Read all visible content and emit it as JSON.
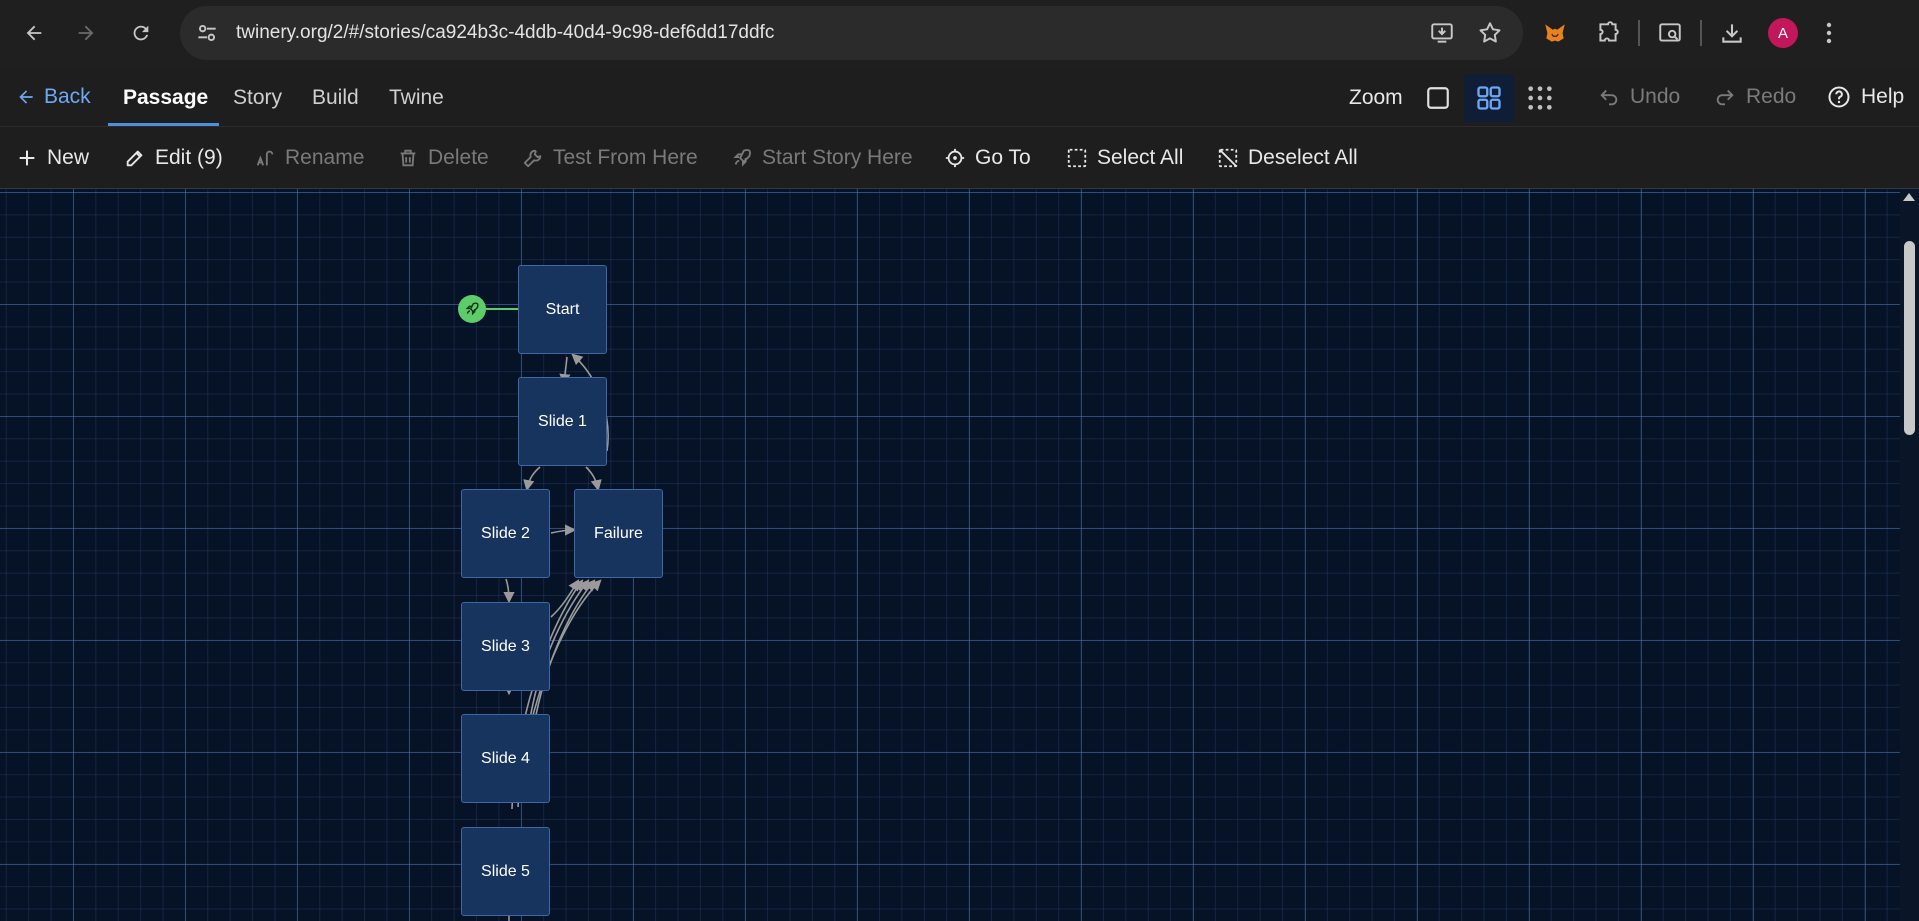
{
  "browser": {
    "url": "twinery.org/2/#/stories/ca924b3c-4ddb-40d4-9c98-def6dd17ddfc",
    "avatar_letter": "A"
  },
  "topbar": {
    "back_label": "Back",
    "tabs": [
      {
        "label": "Passage",
        "active": true
      },
      {
        "label": "Story",
        "active": false
      },
      {
        "label": "Build",
        "active": false
      },
      {
        "label": "Twine",
        "active": false
      }
    ],
    "zoom_label": "Zoom",
    "undo_label": "Undo",
    "redo_label": "Redo",
    "help_label": "Help"
  },
  "actions": {
    "new_label": "New",
    "edit_label": "Edit (9)",
    "rename_label": "Rename",
    "delete_label": "Delete",
    "test_label": "Test From Here",
    "start_label": "Start Story Here",
    "goto_label": "Go To",
    "select_all_label": "Select All",
    "deselect_all_label": "Deselect All"
  },
  "passages": [
    {
      "name": "Start"
    },
    {
      "name": "Slide 1"
    },
    {
      "name": "Slide 2"
    },
    {
      "name": "Failure"
    },
    {
      "name": "Slide 3"
    },
    {
      "name": "Slide 4"
    },
    {
      "name": "Slide 5"
    }
  ],
  "colors": {
    "accent": "#4e8ee0",
    "passage_fill": "#17345e",
    "start_badge": "#5fcc6b",
    "canvas_bg": "#061326"
  }
}
